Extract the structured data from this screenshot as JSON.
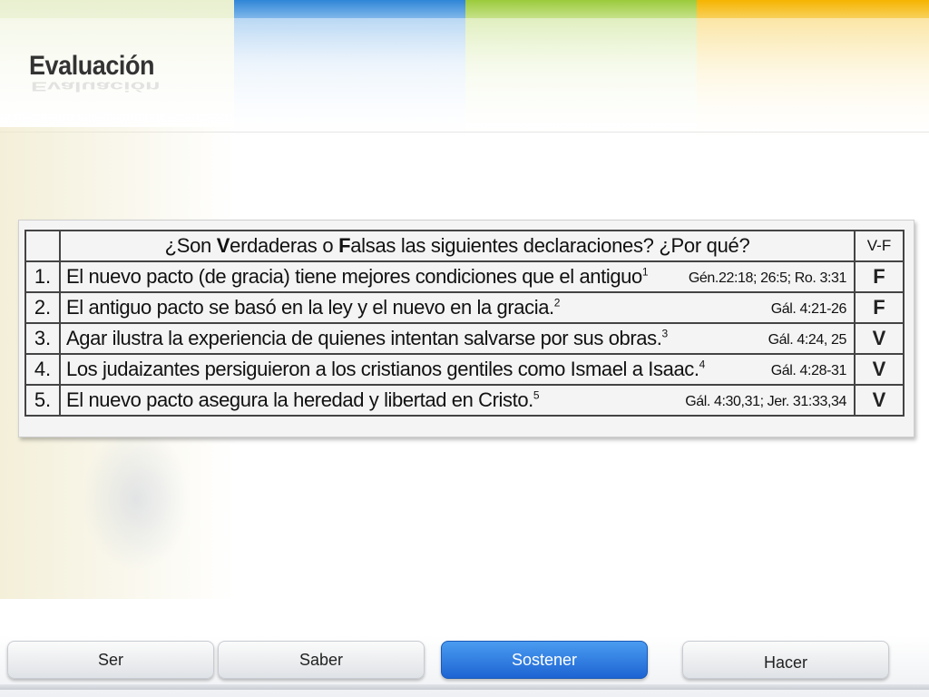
{
  "page": {
    "title": "Evaluación"
  },
  "table": {
    "header": {
      "prefix": "¿Son ",
      "bold_v": "V",
      "mid1": "erdaderas o ",
      "bold_f": "F",
      "mid2": "alsas las siguientes declaraciones? ¿Por qué?",
      "vf": "V-F"
    },
    "rows": [
      {
        "num": "1.",
        "text": "El nuevo pacto (de gracia) tiene mejores condiciones que el antiguo",
        "sup": "1",
        "ref": "Gén.22:18; 26:5; Ro. 3:31",
        "answer": "F"
      },
      {
        "num": "2.",
        "text": "El antiguo pacto se basó en la ley y el nuevo en la gracia.",
        "sup": "2",
        "ref": "Gál. 4:21-26",
        "answer": "F"
      },
      {
        "num": "3.",
        "text": "Agar ilustra la experiencia de quienes intentan salvarse por sus obras.",
        "sup": "3",
        "ref": "Gál. 4:24, 25",
        "answer": "V"
      },
      {
        "num": "4.",
        "text": "Los judaizantes persiguieron a los cristianos gentiles como Ismael a Isaac.",
        "sup": "4",
        "ref": "Gál. 4:28-31",
        "answer": "V"
      },
      {
        "num": "5.",
        "text": "El nuevo pacto asegura la heredad y libertad en Cristo.",
        "sup": "5",
        "ref": "Gál. 4:30,31; Jer. 31:33,34",
        "answer": "V"
      }
    ]
  },
  "tabs": [
    {
      "label": "Ser"
    },
    {
      "label": "Saber"
    },
    {
      "label": "Sostener"
    },
    {
      "label": "Hacer"
    }
  ],
  "colors": {
    "active_tab": "#1d64d3",
    "band_blue": "#2f86d6",
    "band_green": "#8fc43a",
    "band_yellow": "#f5b300"
  }
}
